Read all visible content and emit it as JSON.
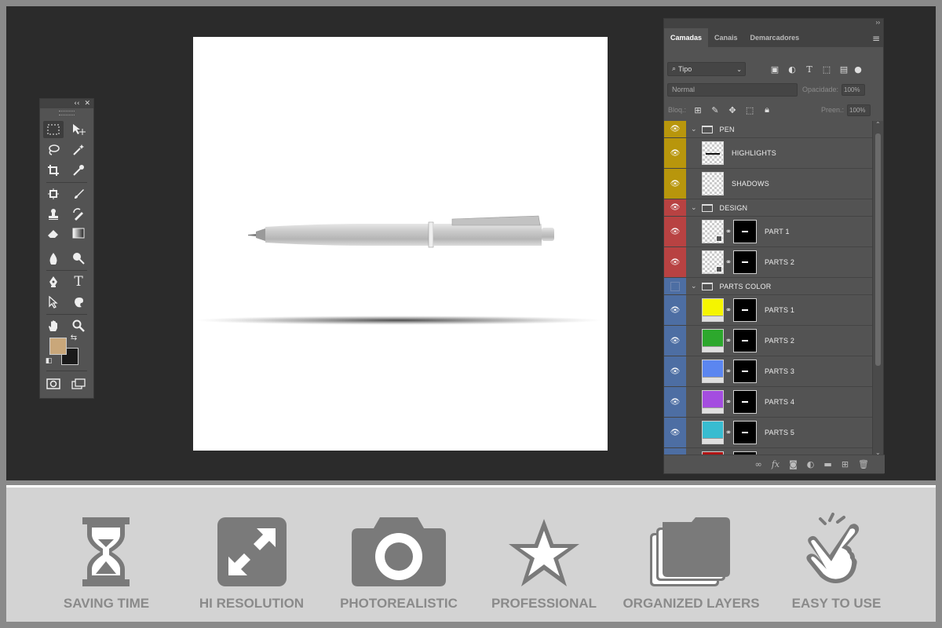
{
  "toolbox": {
    "header_collapse": "‹‹",
    "header_close": "✕",
    "foreground_color": "#C9A77A",
    "background_color": "#1A1A1A"
  },
  "layers_panel": {
    "collapse_glyph": "››",
    "tabs": [
      "Camadas",
      "Canais",
      "Demarcadores"
    ],
    "active_tab": "Camadas",
    "filter": {
      "value": "Tipo"
    },
    "blend_mode": "Normal",
    "opacity_label": "Opacidade:",
    "opacity_value": "100%",
    "lock_label": "Bloq.:",
    "fill_label": "Preen.:",
    "fill_value": "100%",
    "layers": [
      {
        "name": "PEN",
        "kind": "group",
        "color": "#B8960C",
        "visible": true
      },
      {
        "name": "HIGHLIGHTS",
        "kind": "layer",
        "color": "#B8960C",
        "visible": true
      },
      {
        "name": "SHADOWS",
        "kind": "layer",
        "color": "#B8960C",
        "visible": true
      },
      {
        "name": "DESIGN",
        "kind": "group",
        "color": "#B84242",
        "visible": true
      },
      {
        "name": "PART 1",
        "kind": "smart",
        "color": "#B84242",
        "visible": true
      },
      {
        "name": "PARTS 2",
        "kind": "smart",
        "color": "#B84242",
        "visible": true
      },
      {
        "name": "PARTS COLOR",
        "kind": "group",
        "color": "#4D6EA3",
        "visible": false
      },
      {
        "name": "PARTS 1",
        "kind": "fill",
        "color": "#4D6EA3",
        "swatch": "#F5F500",
        "visible": true
      },
      {
        "name": "PARTS 2",
        "kind": "fill",
        "color": "#4D6EA3",
        "swatch": "#2DA82D",
        "visible": true
      },
      {
        "name": "PARTS 3",
        "kind": "fill",
        "color": "#4D6EA3",
        "swatch": "#5B86F0",
        "visible": true
      },
      {
        "name": "PARTS 4",
        "kind": "fill",
        "color": "#4D6EA3",
        "swatch": "#A44DE0",
        "visible": true
      },
      {
        "name": "PARTS 5",
        "kind": "fill",
        "color": "#4D6EA3",
        "swatch": "#38BCD0",
        "visible": true
      },
      {
        "name": "",
        "kind": "fill",
        "color": "#4D6EA3",
        "swatch": "#B01515",
        "visible": true
      }
    ],
    "footer_fx": "fx"
  },
  "features": [
    {
      "label": "SAVING TIME",
      "icon": "hourglass-icon"
    },
    {
      "label": "HI RESOLUTION",
      "icon": "expand-arrows-icon"
    },
    {
      "label": "PHOTOREALISTIC",
      "icon": "camera-icon"
    },
    {
      "label": "PROFESSIONAL",
      "icon": "star-icon"
    },
    {
      "label": "ORGANIZED LAYERS",
      "icon": "layers-stack-icon"
    },
    {
      "label": "EASY TO USE",
      "icon": "pointing-hand-icon"
    }
  ]
}
